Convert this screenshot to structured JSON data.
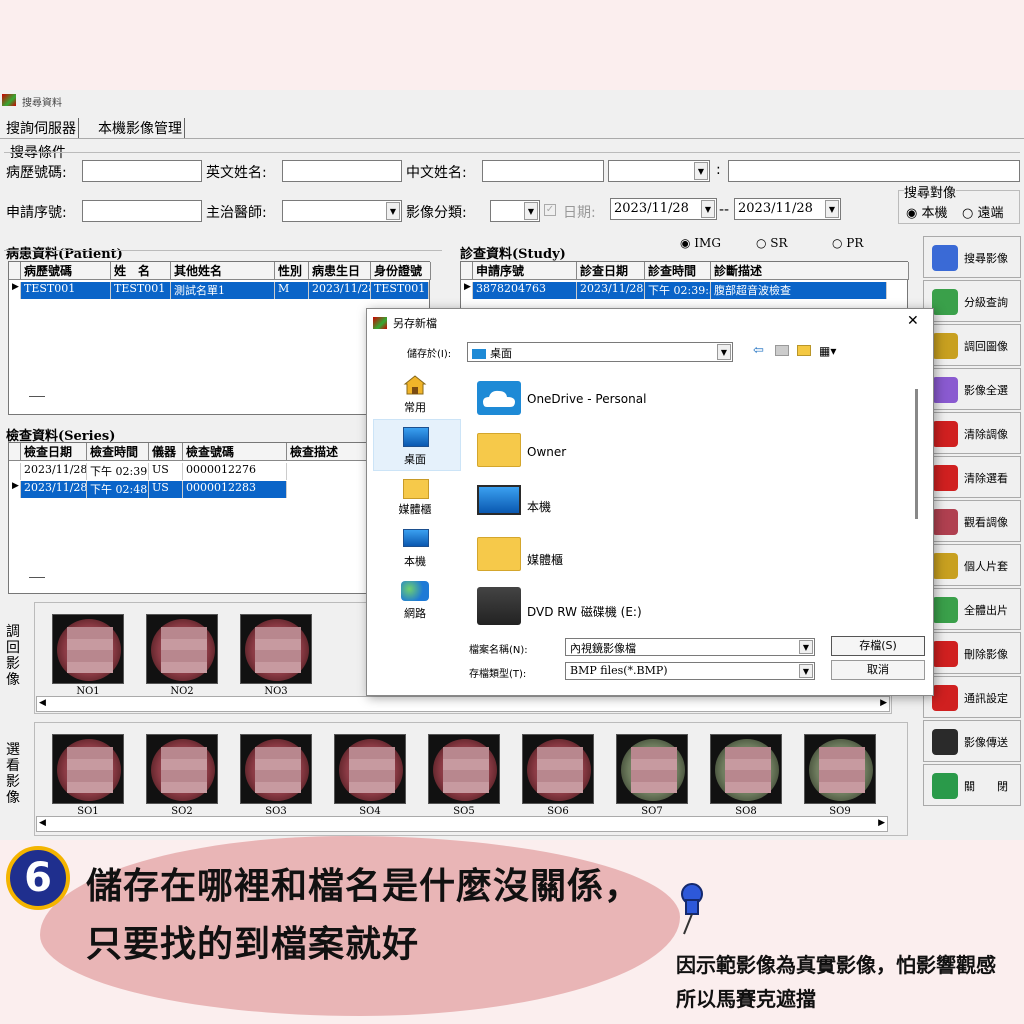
{
  "window": {
    "title": "搜尋資料",
    "tabs": [
      "搜詢伺服器",
      "本機影像管理"
    ]
  },
  "criteria": {
    "group_label": "搜尋條件",
    "chart_no_label": "病歷號碼",
    "eng_name_label": "英文姓名",
    "chi_name_label": "中文姓名",
    "app_no_label": "申請序號",
    "doctor_label": "主治醫師",
    "image_class_label": "影像分類",
    "date_label": "日期",
    "date_from": "2023/11/28",
    "date_to": "2023/11/28",
    "date_sep": "--",
    "target_label": "搜尋對像",
    "target_local": "本機",
    "target_remote": "遠端",
    "type_img": "IMG",
    "type_sr": "SR",
    "type_pr": "PR"
  },
  "patient": {
    "title": "病患資料(Patient)",
    "headers": [
      "病歷號碼",
      "姓　名",
      "其他姓名",
      "性別",
      "病患生日",
      "身份證號"
    ],
    "rows": [
      [
        "TEST001",
        "TEST001",
        "測試名單1",
        "M",
        "2023/11/28",
        "TEST001"
      ]
    ]
  },
  "study": {
    "title": "診查資料(Study)",
    "headers": [
      "申請序號",
      "診查日期",
      "診查時間",
      "診斷描述"
    ],
    "rows": [
      [
        "3878204763",
        "2023/11/28",
        "下午 02:39:5",
        "腹部超音波檢查"
      ]
    ]
  },
  "series": {
    "title": "檢查資料(Series)",
    "headers": [
      "檢查日期",
      "檢查時間",
      "儀器",
      "檢查號碼",
      "檢查描述"
    ],
    "rows": [
      [
        "2023/11/28",
        "下午 02:39:",
        "US",
        "0000012276",
        ""
      ],
      [
        "2023/11/28",
        "下午 02:48:",
        "US",
        "0000012283",
        ""
      ]
    ]
  },
  "strip_retrieve": {
    "label": "調回影像",
    "items": [
      "NO1",
      "NO2",
      "NO3"
    ]
  },
  "strip_view": {
    "label": "選看影像",
    "items": [
      "SO1",
      "SO2",
      "SO3",
      "SO4",
      "SO5",
      "SO6",
      "SO7",
      "SO8",
      "SO9"
    ]
  },
  "buttons": [
    "搜尋影像",
    "分級查詢",
    "調回圖像",
    "影像全選",
    "清除調像",
    "清除選看",
    "觀看調像",
    "個人片套",
    "全體出片",
    "刪除影像",
    "通訊設定",
    "影像傳送",
    "關　　閉"
  ],
  "dialog": {
    "title": "另存新檔",
    "save_in_label": "儲存於(I):",
    "save_in_value": "桌面",
    "nav": [
      "常用",
      "桌面",
      "媒體櫃",
      "本機",
      "網路"
    ],
    "files": [
      "OneDrive - Personal",
      "Owner",
      "本機",
      "媒體櫃",
      "DVD RW 磁碟機 (E:)"
    ],
    "filename_label": "檔案名稱(N):",
    "filename_value": "內視鏡影像檔",
    "filetype_label": "存檔類型(T):",
    "filetype_value": "BMP files(*.BMP)",
    "save_button": "存檔(S)",
    "cancel_button": "取消",
    "close_glyph": "✕"
  },
  "annotation": {
    "step_number": "6",
    "bubble_text": "儲存在哪裡和檔名是什麼沒關係，只要找的到檔案就好",
    "note_text": "因示範影像為真實影像，怕影響觀感所以馬賽克遮擋"
  }
}
